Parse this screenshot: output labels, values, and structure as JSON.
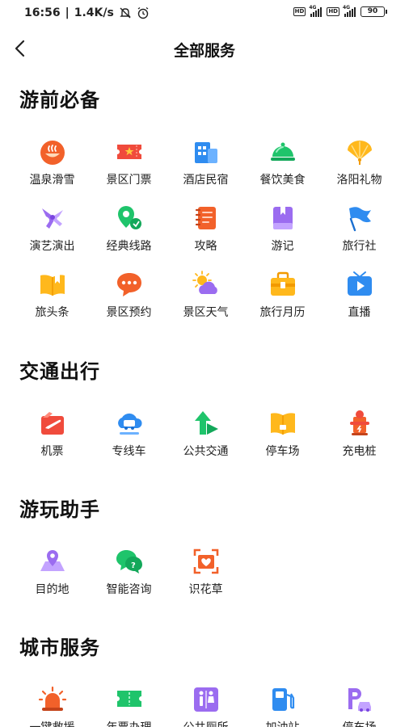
{
  "status": {
    "time": "16:56",
    "speed": "1.4K/s",
    "hd": "HD",
    "net": "4G",
    "battery": "90"
  },
  "header": {
    "title": "全部服务"
  },
  "sections": [
    {
      "title": "游前必备",
      "items": [
        {
          "label": "温泉滑雪",
          "icon": "hot-spring-icon"
        },
        {
          "label": "景区门票",
          "icon": "ticket-icon"
        },
        {
          "label": "酒店民宿",
          "icon": "hotel-icon"
        },
        {
          "label": "餐饮美食",
          "icon": "food-cloche-icon"
        },
        {
          "label": "洛阳礼物",
          "icon": "fan-gift-icon"
        },
        {
          "label": "演艺演出",
          "icon": "performance-icon"
        },
        {
          "label": "经典线路",
          "icon": "route-icon"
        },
        {
          "label": "攻略",
          "icon": "guide-book-icon"
        },
        {
          "label": "游记",
          "icon": "travel-note-icon"
        },
        {
          "label": "旅行社",
          "icon": "flag-icon"
        },
        {
          "label": "旅头条",
          "icon": "headline-book-icon"
        },
        {
          "label": "景区预约",
          "icon": "chat-bubble-icon"
        },
        {
          "label": "景区天气",
          "icon": "weather-icon"
        },
        {
          "label": "旅行月历",
          "icon": "suitcase-icon"
        },
        {
          "label": "直播",
          "icon": "live-tv-icon"
        }
      ]
    },
    {
      "title": "交通出行",
      "items": [
        {
          "label": "机票",
          "icon": "plane-ticket-icon"
        },
        {
          "label": "专线车",
          "icon": "bus-cloud-icon"
        },
        {
          "label": "公共交通",
          "icon": "transit-arrow-icon"
        },
        {
          "label": "停车场",
          "icon": "parking-book-icon"
        },
        {
          "label": "充电桩",
          "icon": "charging-pile-icon"
        }
      ]
    },
    {
      "title": "游玩助手",
      "items": [
        {
          "label": "目的地",
          "icon": "destination-icon"
        },
        {
          "label": "智能咨询",
          "icon": "smart-consult-icon"
        },
        {
          "label": "识花草",
          "icon": "flower-scan-icon"
        }
      ]
    },
    {
      "title": "城市服务",
      "items": [
        {
          "label": "一键救援",
          "icon": "alarm-icon"
        },
        {
          "label": "年票办理",
          "icon": "annual-ticket-icon"
        },
        {
          "label": "公共厕所",
          "icon": "restroom-icon"
        },
        {
          "label": "加油站",
          "icon": "gas-station-icon"
        },
        {
          "label": "停车场",
          "icon": "parking-car-icon"
        }
      ]
    }
  ],
  "colors": {
    "orange": "#f2612a",
    "red": "#f04b3c",
    "blue": "#2f8cf0",
    "green": "#1fc46b",
    "yellow": "#ffb81c",
    "purple": "#9b6cf0"
  }
}
